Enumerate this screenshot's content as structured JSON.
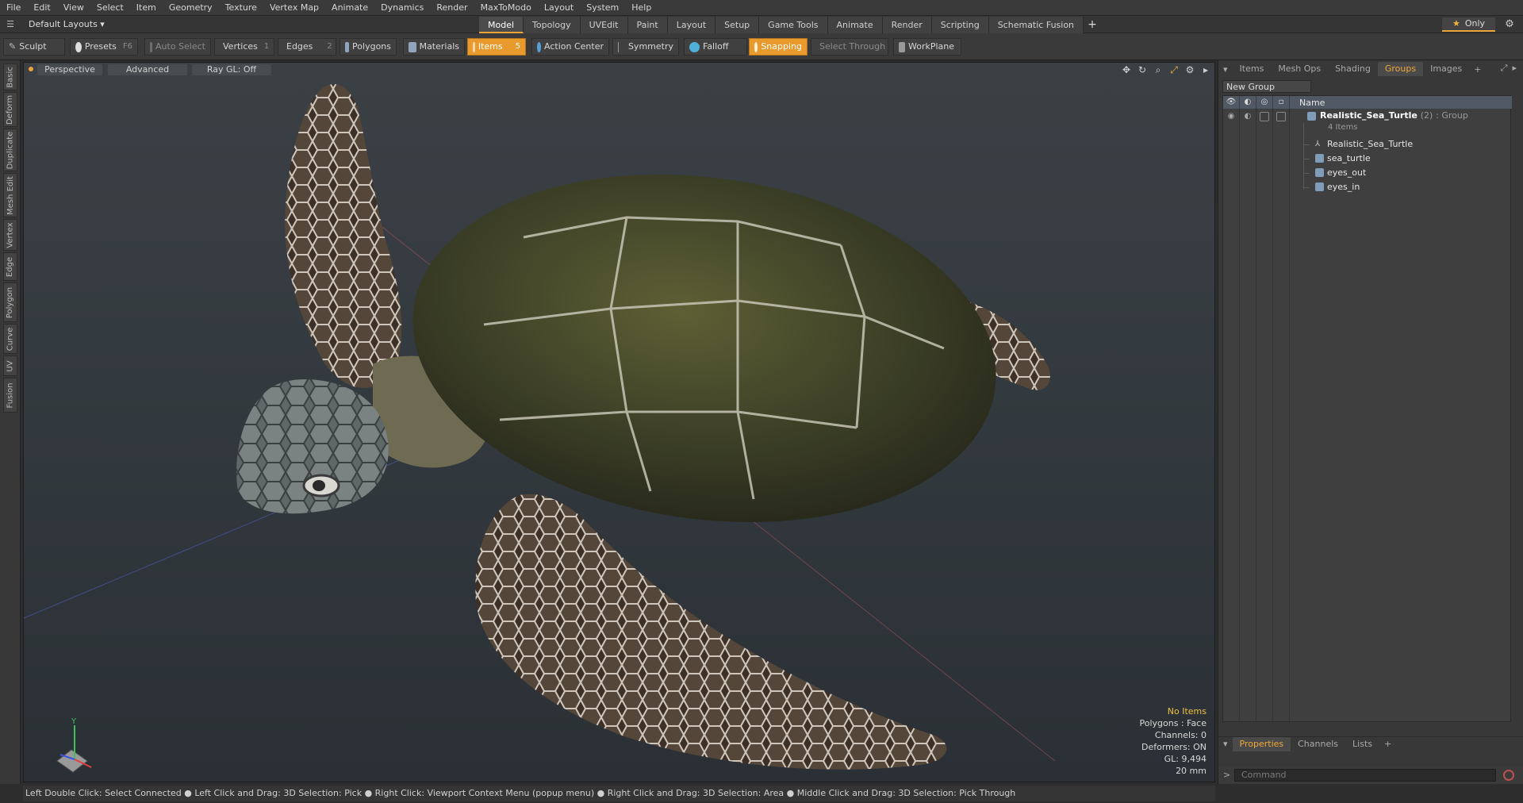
{
  "menu": [
    "File",
    "Edit",
    "View",
    "Select",
    "Item",
    "Geometry",
    "Texture",
    "Vertex Map",
    "Animate",
    "Dynamics",
    "Render",
    "MaxToModo",
    "Layout",
    "System",
    "Help"
  ],
  "layout": {
    "selector": "Default Layouts ▾",
    "tabs": [
      "Model",
      "Topology",
      "UVEdit",
      "Paint",
      "Layout",
      "Setup",
      "Game Tools",
      "Animate",
      "Render",
      "Scripting",
      "Schematic Fusion"
    ],
    "active_tab": "Model",
    "plus": "+",
    "only_label": "Only"
  },
  "toolbar": {
    "sculpt": "Sculpt",
    "presets": "Presets",
    "presets_key": "F6",
    "auto_select": "Auto Select",
    "vertices": "Vertices",
    "vertices_key": "1",
    "edges": "Edges",
    "edges_key": "2",
    "polygons": "Polygons",
    "materials": "Materials",
    "items": "Items",
    "items_key": "5",
    "action_center": "Action Center",
    "symmetry": "Symmetry",
    "falloff": "Falloff",
    "snapping": "Snapping",
    "select_through": "Select Through",
    "workplane": "WorkPlane"
  },
  "left_tabs": [
    "Basic",
    "Deform",
    "Duplicate",
    "Mesh Edit",
    "Vertex",
    "Edge",
    "Polygon",
    "Curve",
    "UV",
    "Fusion"
  ],
  "viewport": {
    "view": "Perspective",
    "mode": "Advanced",
    "raygl": "Ray GL: Off",
    "axis_y": "Y",
    "info": {
      "no_items": "No Items",
      "polygons": "Polygons : Face",
      "channels": "Channels: 0",
      "deformers": "Deformers: ON",
      "gl": "GL: 9,494",
      "scale": "20 mm"
    }
  },
  "right_panel": {
    "tabs": [
      "Items",
      "Mesh Ops",
      "Shading",
      "Groups",
      "Images"
    ],
    "active_tab": "Groups",
    "plus": "+",
    "new_group": "New Group",
    "name_header": "Name",
    "group": {
      "name": "Realistic_Sea_Turtle",
      "count": "(2)",
      "type": ": Group",
      "items_label": "4 Items"
    },
    "children": [
      "Realistic_Sea_Turtle",
      "sea_turtle",
      "eyes_out",
      "eyes_in"
    ],
    "bottom_tabs": [
      "Properties",
      "Channels",
      "Lists"
    ],
    "bottom_active": "Properties",
    "command_placeholder": "Command"
  },
  "status": {
    "text": "Left Double Click: Select Connected ● Left Click and Drag: 3D Selection: Pick ● Right Click: Viewport Context Menu (popup menu) ● Right Click and Drag: 3D Selection: Area ● Middle Click and Drag: 3D Selection: Pick Through"
  },
  "colors": {
    "accent": "#e89a2c",
    "active_tab_text": "#f0a83a",
    "warn": "#f0c040"
  }
}
